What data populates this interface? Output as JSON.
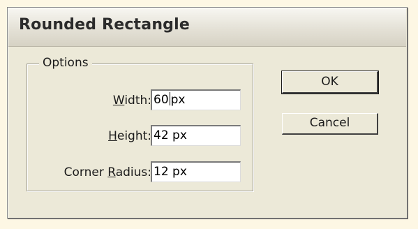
{
  "dialog": {
    "title": "Rounded Rectangle"
  },
  "options": {
    "legend": "Options",
    "width": {
      "label_mnemonic": "W",
      "label_rest": "idth:",
      "value_before_caret": "60",
      "value_after_caret": "px"
    },
    "height": {
      "label_mnemonic": "H",
      "label_rest": "eight:",
      "value": "42 px"
    },
    "corner_radius": {
      "label_prefix": "Corner ",
      "label_mnemonic": "R",
      "label_rest": "adius:",
      "value": "12 px"
    }
  },
  "buttons": {
    "ok_label": "OK",
    "cancel_label": "Cancel"
  }
}
